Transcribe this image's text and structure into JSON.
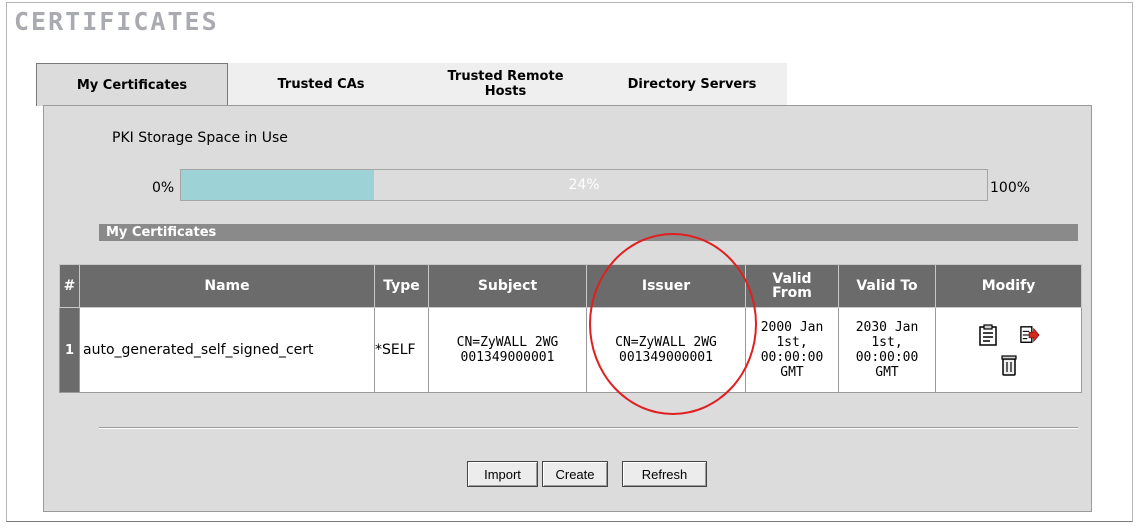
{
  "page": {
    "title": "CERTIFICATES"
  },
  "tabs": [
    {
      "label": "My Certificates",
      "active": true
    },
    {
      "label": "Trusted CAs",
      "active": false
    },
    {
      "label": "Trusted Remote Hosts",
      "active": false
    },
    {
      "label": "Directory Servers",
      "active": false
    }
  ],
  "storage": {
    "label": "PKI Storage Space in Use",
    "min_label": "0%",
    "max_label": "100%",
    "usage_text": "24%",
    "usage_fraction": 0.24
  },
  "section": {
    "title": "My Certificates"
  },
  "table": {
    "headers": [
      "#",
      "Name",
      "Type",
      "Subject",
      "Issuer",
      "Valid From",
      "Valid To",
      "Modify"
    ],
    "rows": [
      {
        "num": "1",
        "name": "auto_generated_self_signed_cert",
        "type": "*SELF",
        "subject": "CN=ZyWALL 2WG 001349000001",
        "issuer": "CN=ZyWALL 2WG 001349000001",
        "valid_from": "2000 Jan 1st, 00:00:00 GMT",
        "valid_to": "2030 Jan 1st, 00:00:00 GMT",
        "modify_icons": [
          "details-icon",
          "export-icon",
          "trash-icon"
        ]
      }
    ]
  },
  "buttons": {
    "import": "Import",
    "create": "Create",
    "refresh": "Refresh"
  },
  "colors": {
    "progress_fill": "#9dd3d6",
    "header_bg": "#6b6b6b",
    "highlight_circle": "#e02020"
  }
}
